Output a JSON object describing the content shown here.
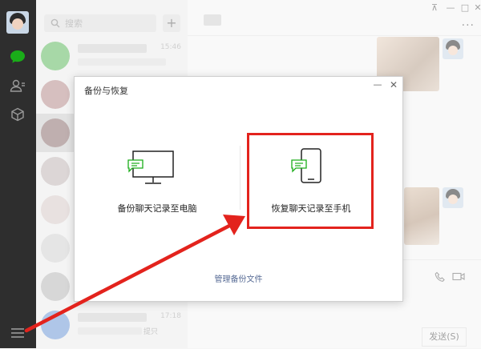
{
  "sidebar": {
    "icons": [
      "avatar",
      "chat-icon",
      "contacts-icon",
      "collection-icon",
      "menu-icon"
    ]
  },
  "chat_list": {
    "search": {
      "placeholder": "搜索"
    },
    "add_label": "+",
    "items": [
      {
        "time": "15:46",
        "avatar_color": "#5fb85f"
      },
      {
        "time": "",
        "avatar_color": "#b48a8a"
      },
      {
        "time": "",
        "avatar_color": "#8a6e6e"
      },
      {
        "time": "",
        "avatar_color": "#bfb5b5"
      },
      {
        "time": "",
        "avatar_color": "#d6c9c6"
      },
      {
        "time": "",
        "avatar_color": "#cfcfcf"
      },
      {
        "time": "",
        "avatar_color": "#b7b7b7"
      },
      {
        "time": "17:18",
        "avatar_color": "#6e98d6"
      }
    ],
    "last_preview_suffix": "提只"
  },
  "main": {
    "send_label": "发送(S)"
  },
  "dialog": {
    "title": "备份与恢复",
    "option_backup": "备份聊天记录至电脑",
    "option_restore": "恢复聊天记录至手机",
    "manage_link": "管理备份文件"
  },
  "colors": {
    "wechat_green": "#1aad19",
    "highlight_red": "#e3231d",
    "link_blue": "#576b95"
  }
}
